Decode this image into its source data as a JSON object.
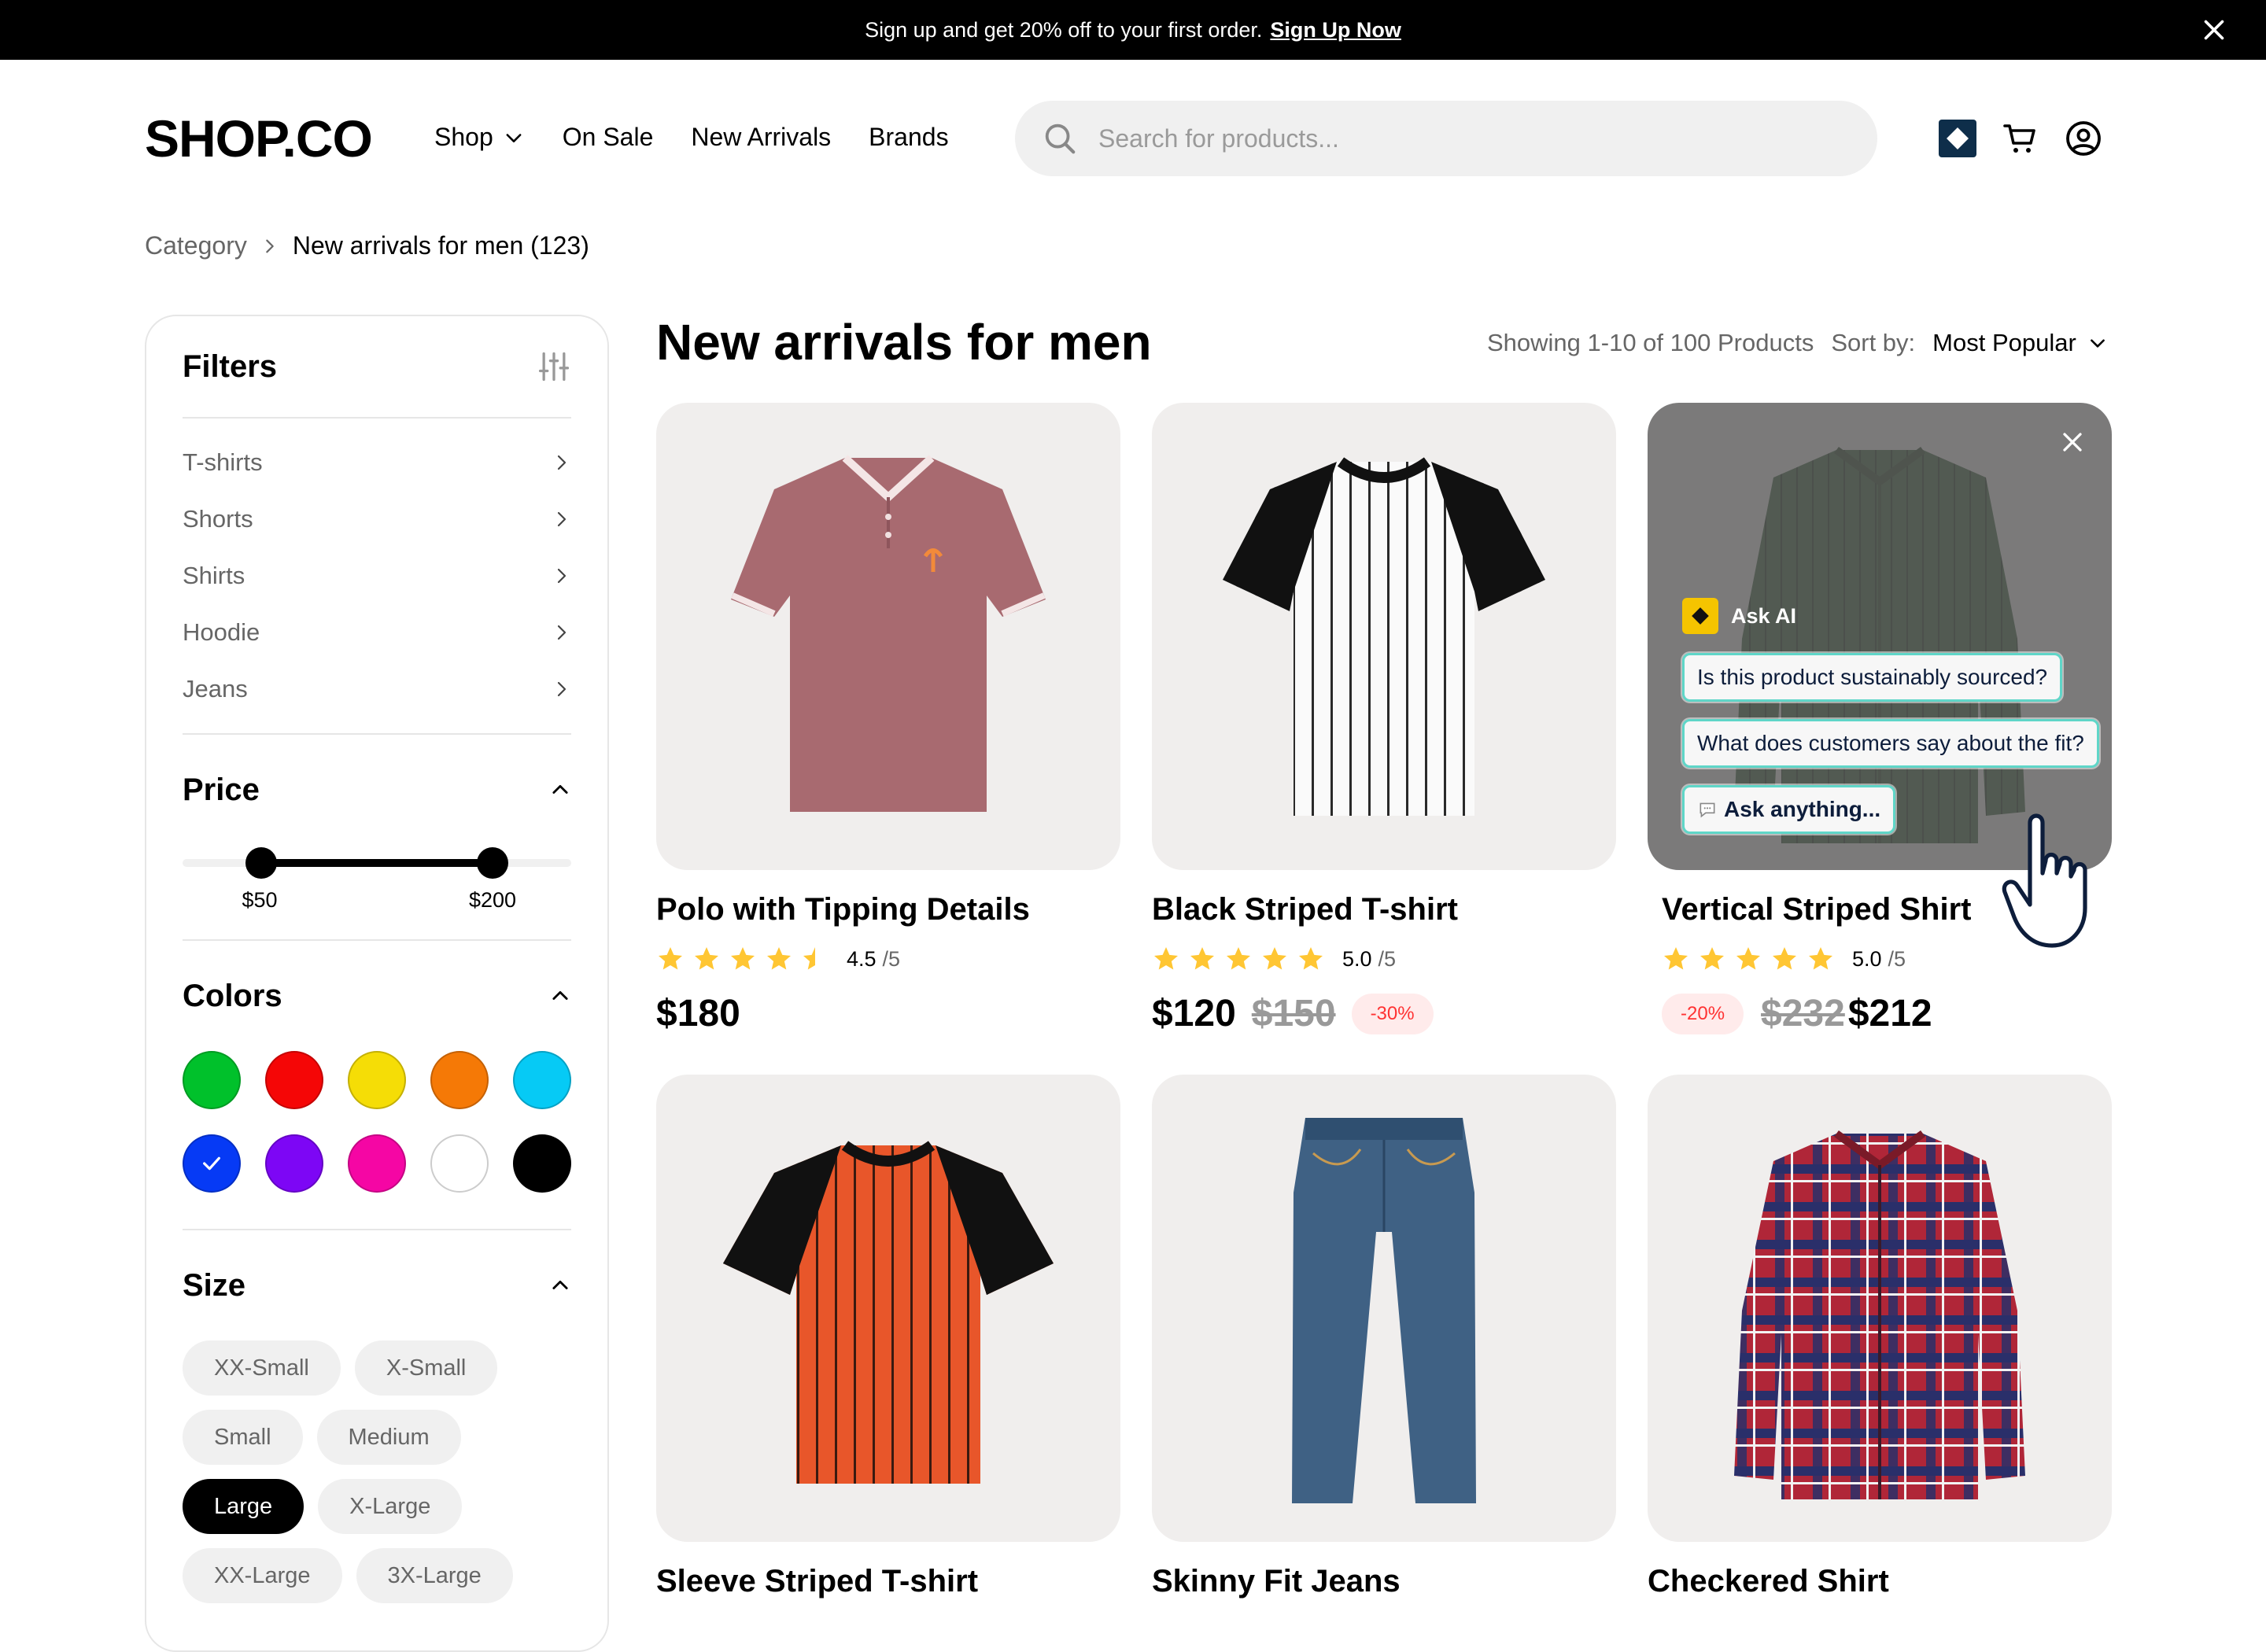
{
  "banner": {
    "text": "Sign up and get 20% off to your first order.",
    "link": "Sign Up Now"
  },
  "header": {
    "logo": "SHOP.CO",
    "nav": [
      "Shop",
      "On Sale",
      "New Arrivals",
      "Brands"
    ],
    "search_placeholder": "Search for products...",
    "icons": [
      "ai-assistant-icon",
      "cart-icon",
      "account-icon"
    ]
  },
  "breadcrumb": {
    "parent": "Category",
    "current": "New arrivals for men (123)"
  },
  "filters": {
    "title": "Filters",
    "categories": [
      "T-shirts",
      "Shorts",
      "Shirts",
      "Hoodie",
      "Jeans"
    ],
    "price": {
      "title": "Price",
      "min_label": "$50",
      "max_label": "$200",
      "min_value": 50,
      "max_value": 200
    },
    "colors": {
      "title": "Colors",
      "swatches": [
        {
          "name": "green",
          "hex": "#00C12B"
        },
        {
          "name": "red",
          "hex": "#F50606"
        },
        {
          "name": "yellow",
          "hex": "#F5DD06"
        },
        {
          "name": "orange",
          "hex": "#F57906"
        },
        {
          "name": "cyan",
          "hex": "#06CAF5"
        },
        {
          "name": "blue",
          "hex": "#063AF5",
          "selected": true
        },
        {
          "name": "purple",
          "hex": "#7D06F5"
        },
        {
          "name": "pink",
          "hex": "#F506A4"
        },
        {
          "name": "white",
          "hex": "#FFFFFF"
        },
        {
          "name": "black",
          "hex": "#000000"
        }
      ]
    },
    "size": {
      "title": "Size",
      "options": [
        "XX-Small",
        "X-Small",
        "Small",
        "Medium",
        "Large",
        "X-Large",
        "XX-Large",
        "3X-Large"
      ],
      "selected": "Large"
    }
  },
  "main": {
    "title": "New arrivals for men",
    "showing": "Showing 1-10 of 100 Products",
    "sort_label": "Sort by:",
    "sort_value": "Most Popular"
  },
  "products": [
    {
      "name": "Polo with Tipping Details",
      "rating": 4.5,
      "score": "4.5",
      "den": "/5",
      "price": "$180"
    },
    {
      "name": "Black Striped T-shirt",
      "rating": 5.0,
      "score": "5.0",
      "den": "/5",
      "price": "$120",
      "old_price": "$150",
      "discount": "-30%"
    },
    {
      "name": "Vertical Striped Shirt",
      "rating": 5.0,
      "score": "5.0",
      "den": "/5",
      "price": "$212",
      "old_price": "$232",
      "discount": "-20%"
    },
    {
      "name": "Sleeve Striped T-shirt"
    },
    {
      "name": "Skinny Fit Jeans"
    },
    {
      "name": "Checkered Shirt"
    }
  ],
  "ai_overlay": {
    "title": "Ask AI",
    "suggestions": [
      "Is this product sustainably sourced?",
      "What does customers say about the fit?"
    ],
    "ask": "Ask anything..."
  },
  "colors": {
    "star": "#FFC633",
    "discount_text": "#FF3333",
    "discount_bg": "#FFEBEB",
    "card_bg": "#F0EEED",
    "ai_accent": "#F5C400",
    "ai_chip_border": "#5FD6C8"
  }
}
